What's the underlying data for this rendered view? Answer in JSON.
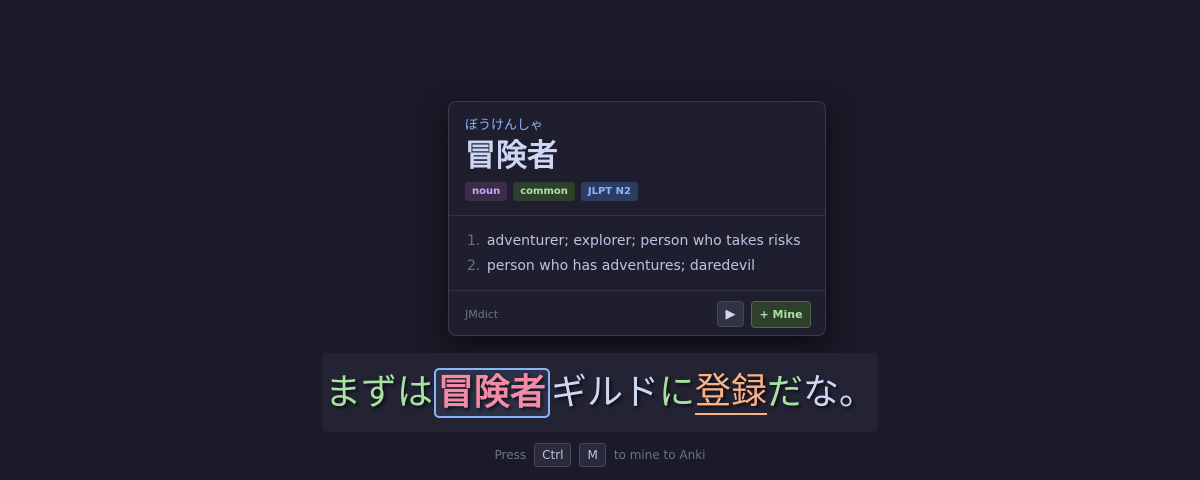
{
  "popup": {
    "reading": "ぼうけんしゃ",
    "headword": "冒険者",
    "tags": [
      "noun",
      "common",
      "JLPT N2"
    ],
    "definitions": [
      {
        "num": "1.",
        "text": "adventurer; explorer; person who takes risks"
      },
      {
        "num": "2.",
        "text": "person who has adventures; daredevil"
      }
    ],
    "source": "JMdict",
    "play_icon": "▶",
    "mine_label": "+ Mine"
  },
  "subtitle": {
    "segments": [
      {
        "text": "まずは",
        "style": "green"
      },
      {
        "text": "冒険者",
        "style": "highlighted"
      },
      {
        "text": "ギルド",
        "style": "white"
      },
      {
        "text": "に",
        "style": "green"
      },
      {
        "text": "登録",
        "style": "orange-underlined"
      },
      {
        "text": "だ",
        "style": "green"
      },
      {
        "text": "な。",
        "style": "white"
      }
    ]
  },
  "hint": {
    "prefix": "Press",
    "key1": "Ctrl",
    "key2": "M",
    "suffix": "to mine to Anki"
  },
  "colors": {
    "background": "#1a1a28",
    "accent_blue": "#89b4fa",
    "accent_green": "#a6e3a1",
    "accent_pink": "#f38ba8",
    "accent_orange": "#fab387"
  }
}
